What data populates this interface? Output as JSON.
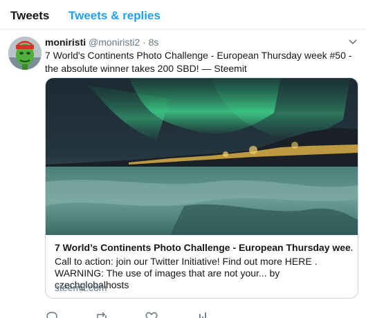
{
  "tabs": [
    {
      "label": "Tweets",
      "active": true
    },
    {
      "label": "Tweets & replies",
      "active": false
    }
  ],
  "tweet": {
    "name": "moniristi",
    "handle": "@moniristi2",
    "separator": "·",
    "time": "8s",
    "text": "7 World's Continents Photo Challenge - European Thursday week #50 - the absolute winner takes 200 SBD! — Steemit",
    "card": {
      "title": "7 World’s Continents Photo Challenge - European Thursday wee...",
      "description": "Call to action: join our Twitter Initiative! Find out more HERE . WARNING: The use of images that are not your... by czechglobalhosts",
      "domain": "steemit.com"
    },
    "icons": {
      "more": "chevron-down-icon",
      "reply": "reply-icon",
      "retweet": "retweet-icon",
      "like": "heart-icon",
      "stats": "bar-chart-icon"
    }
  },
  "colors": {
    "accent": "#1da1f2",
    "text": "#14171a",
    "secondary": "#657786",
    "border": "#e6ecf0"
  }
}
